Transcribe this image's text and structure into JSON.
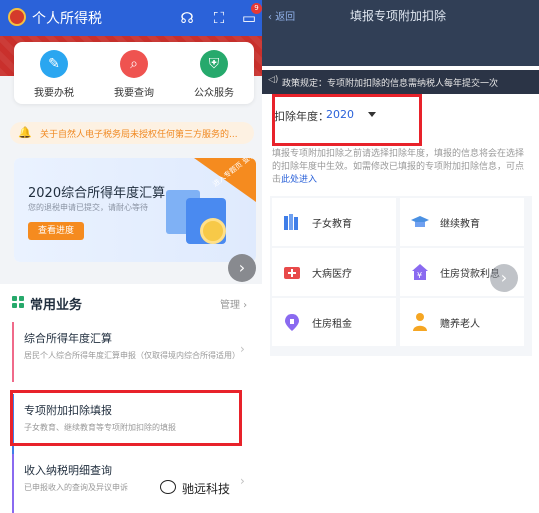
{
  "left": {
    "header": {
      "title": "个人所得税",
      "badge": "9"
    },
    "services": [
      {
        "label": "我要办税",
        "icon": "pen-icon",
        "color": "#2aa6f0",
        "glyph": "✎"
      },
      {
        "label": "我要查询",
        "icon": "search-icon",
        "color": "#ef5350",
        "glyph": "⌕"
      },
      {
        "label": "公众服务",
        "icon": "shield-icon",
        "color": "#26a96c",
        "glyph": "⛨"
      }
    ],
    "notice": "关于自然人电子税务局未授权任何第三方服务的...",
    "annual": {
      "title": "2020综合所得年度汇算",
      "subtitle": "您的退税申请已提交，请耐心等待",
      "button": "查看进度",
      "ribbon": "进入专题页 查看更多资料"
    },
    "common": {
      "title": "常用业务",
      "manage": "管理",
      "items": [
        {
          "title": "综合所得年度汇算",
          "desc": "居民个人综合所得年度汇算申报（仅取得境内综合所得适用）",
          "bar_color": "#f06a8a"
        },
        {
          "title": "专项附加扣除填报",
          "desc": "子女教育、继续教育等专项附加扣除的填报",
          "bar_color": "#3f7ee8"
        },
        {
          "title": "收入纳税明细查询",
          "desc": "已申报收入的查询及异议申诉",
          "bar_color": "#8a6af0"
        }
      ]
    }
  },
  "right": {
    "header": {
      "back": "返回",
      "title": "填报专项附加扣除"
    },
    "policy": "政策规定：专项附加扣除的信息需纳税人每年提交一次",
    "year": {
      "label": "扣除年度：",
      "value": "2020"
    },
    "intro": "填报专项附加扣除之前请选择扣除年度，填报的信息将会在选择的扣除年度中生效。如需修改已填报的专项附加扣除信息，可点击",
    "intro_link": "此处进入",
    "categories": [
      {
        "label": "子女教育",
        "icon": "books-icon",
        "color": "#3f7ee8"
      },
      {
        "label": "继续教育",
        "icon": "graduation-cap-icon",
        "color": "#4a90e2"
      },
      {
        "label": "大病医疗",
        "icon": "medical-kit-icon",
        "color": "#e84a4a"
      },
      {
        "label": "住房贷款利息",
        "icon": "house-loan-icon",
        "color": "#8a6af0"
      },
      {
        "label": "住房租金",
        "icon": "house-rent-icon",
        "color": "#8a6af0"
      },
      {
        "label": "赡养老人",
        "icon": "elderly-icon",
        "color": "#f5a623"
      }
    ]
  },
  "watermark": "驰远科技"
}
